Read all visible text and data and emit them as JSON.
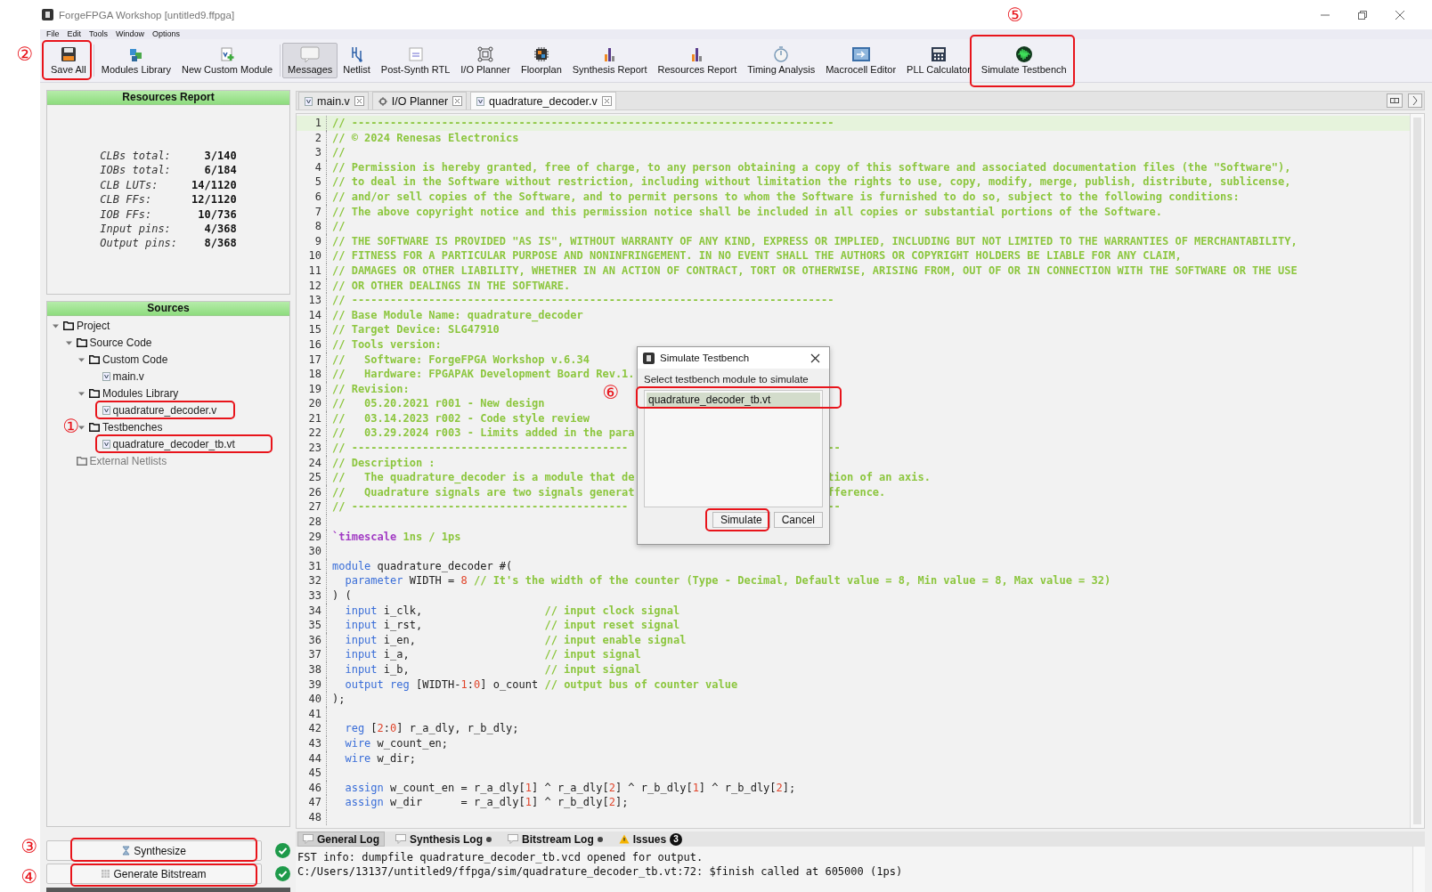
{
  "window": {
    "title": "ForgeFPGA Workshop [untitled9.ffpga]"
  },
  "menu": [
    "File",
    "Edit",
    "Tools",
    "Window",
    "Options"
  ],
  "toolbar": [
    {
      "label": "Save All",
      "pressed": false
    },
    {
      "label": "Modules Library",
      "pressed": false
    },
    {
      "label": "New Custom Module",
      "pressed": false
    },
    {
      "label": "Messages",
      "pressed": true
    },
    {
      "label": "Netlist",
      "pressed": false
    },
    {
      "label": "Post-Synth RTL",
      "pressed": false
    },
    {
      "label": "I/O Planner",
      "pressed": false
    },
    {
      "label": "Floorplan",
      "pressed": false
    },
    {
      "label": "Synthesis Report",
      "pressed": false
    },
    {
      "label": "Resources Report",
      "pressed": false
    },
    {
      "label": "Timing Analysis",
      "pressed": false
    },
    {
      "label": "Macrocell Editor",
      "pressed": false
    },
    {
      "label": "PLL Calculator",
      "pressed": false
    },
    {
      "label": "Simulate Testbench",
      "pressed": false
    }
  ],
  "resources_report": {
    "title": "Resources Report",
    "rows": [
      {
        "label": "CLBs total:",
        "value": "3/140"
      },
      {
        "label": "IOBs total:",
        "value": "6/184"
      },
      {
        "label": "CLB LUTs:",
        "value": "14/1120"
      },
      {
        "label": "CLB FFs:",
        "value": "12/1120"
      },
      {
        "label": "IOB FFs:",
        "value": "10/736"
      },
      {
        "label": "Input pins:",
        "value": "4/368"
      },
      {
        "label": "Output pins:",
        "value": "8/368"
      }
    ]
  },
  "sources": {
    "title": "Sources",
    "tree": [
      {
        "label": "Project",
        "kind": "folder",
        "expanded": true,
        "disabled": false,
        "children": [
          {
            "label": "Source Code",
            "kind": "folder",
            "expanded": true,
            "disabled": false,
            "children": [
              {
                "label": "Custom Code",
                "kind": "folder",
                "expanded": true,
                "disabled": false,
                "children": [
                  {
                    "label": "main.v",
                    "kind": "file",
                    "disabled": false
                  }
                ]
              },
              {
                "label": "Modules Library",
                "kind": "folder",
                "expanded": true,
                "disabled": false,
                "children": [
                  {
                    "label": "quadrature_decoder.v",
                    "kind": "file",
                    "disabled": false
                  }
                ]
              },
              {
                "label": "Testbenches",
                "kind": "folder",
                "expanded": true,
                "disabled": false,
                "children": [
                  {
                    "label": "quadrature_decoder_tb.vt",
                    "kind": "file",
                    "disabled": false
                  }
                ]
              }
            ]
          },
          {
            "label": "External Netlists",
            "kind": "folder",
            "disabled": true
          }
        ]
      }
    ]
  },
  "build_steps": [
    {
      "label": "Synthesize",
      "done": true
    },
    {
      "label": "Generate Bitstream",
      "done": true
    }
  ],
  "editor": {
    "tabs": [
      {
        "label": "main.v",
        "kind": "file",
        "selected": false
      },
      {
        "label": "I/O Planner",
        "kind": "planner",
        "selected": false
      },
      {
        "label": "quadrature_decoder.v",
        "kind": "file",
        "selected": true
      }
    ],
    "lines": [
      {
        "n": "1",
        "parts": [
          [
            {
              "kind": "com",
              "text": "// ---------------------------------------------------------------------------"
            }
          ]
        ]
      },
      {
        "n": "2",
        "parts": [
          [
            {
              "kind": "com",
              "text": "// © 2024 Renesas Electronics"
            }
          ]
        ]
      },
      {
        "n": "3",
        "parts": [
          [
            {
              "kind": "com",
              "text": "//"
            }
          ]
        ]
      },
      {
        "n": "4",
        "parts": [
          [
            {
              "kind": "com",
              "text": "// Permission is hereby granted, free of charge, to any person obtaining a copy of this software and associated documentation files (the \"Software\"),"
            }
          ]
        ]
      },
      {
        "n": "5",
        "parts": [
          [
            {
              "kind": "com",
              "text": "// to deal in the Software without restriction, including without limitation the rights to use, copy, modify, merge, publish, distribute, sublicense,"
            }
          ]
        ]
      },
      {
        "n": "6",
        "parts": [
          [
            {
              "kind": "com",
              "text": "// and/or sell copies of the Software, and to permit persons to whom the Software is furnished to do so, subject to the following conditions:"
            }
          ]
        ]
      },
      {
        "n": "7",
        "parts": [
          [
            {
              "kind": "com",
              "text": "// The above copyright notice and this permission notice shall be included in all copies or substantial portions of the Software."
            }
          ]
        ]
      },
      {
        "n": "8",
        "parts": [
          [
            {
              "kind": "com",
              "text": "//"
            }
          ]
        ]
      },
      {
        "n": "9",
        "parts": [
          [
            {
              "kind": "com",
              "text": "// THE SOFTWARE IS PROVIDED \"AS IS\", WITHOUT WARRANTY OF ANY KIND, EXPRESS OR IMPLIED, INCLUDING BUT NOT LIMITED TO THE WARRANTIES OF MERCHANTABILITY,"
            }
          ]
        ]
      },
      {
        "n": "10",
        "parts": [
          [
            {
              "kind": "com",
              "text": "// FITNESS FOR A PARTICULAR PURPOSE AND NONINFRINGEMENT. IN NO EVENT SHALL THE AUTHORS OR COPYRIGHT HOLDERS BE LIABLE FOR ANY CLAIM,"
            }
          ]
        ]
      },
      {
        "n": "11",
        "parts": [
          [
            {
              "kind": "com",
              "text": "// DAMAGES OR OTHER LIABILITY, WHETHER IN AN ACTION OF CONTRACT, TORT OR OTHERWISE, ARISING FROM, OUT OF OR IN CONNECTION WITH THE SOFTWARE OR THE USE"
            }
          ]
        ]
      },
      {
        "n": "12",
        "parts": [
          [
            {
              "kind": "com",
              "text": "// OR OTHER DEALINGS IN THE SOFTWARE."
            }
          ]
        ]
      },
      {
        "n": "13",
        "parts": [
          [
            {
              "kind": "com",
              "text": "// ---------------------------------------------------------------------------"
            }
          ]
        ]
      },
      {
        "n": "14",
        "parts": [
          [
            {
              "kind": "com",
              "text": "// Base Module Name: quadrature_decoder"
            }
          ]
        ]
      },
      {
        "n": "15",
        "parts": [
          [
            {
              "kind": "com",
              "text": "// Target Device: SLG47910"
            }
          ]
        ]
      },
      {
        "n": "16",
        "parts": [
          [
            {
              "kind": "com",
              "text": "// Tools version:"
            }
          ]
        ]
      },
      {
        "n": "17",
        "parts": [
          [
            {
              "kind": "com",
              "text": "//   Software: ForgeFPGA Workshop v.6.34"
            }
          ]
        ]
      },
      {
        "n": "18",
        "parts": [
          [
            {
              "kind": "com",
              "text": "//   Hardware: FPGAPAK Development Board Rev.1."
            }
          ]
        ]
      },
      {
        "n": "19",
        "parts": [
          [
            {
              "kind": "com",
              "text": "// Revision:"
            }
          ]
        ]
      },
      {
        "n": "20",
        "parts": [
          [
            {
              "kind": "com",
              "text": "//   05.20.2021 r001 - New design"
            }
          ]
        ]
      },
      {
        "n": "21",
        "parts": [
          [
            {
              "kind": "com",
              "text": "//   03.14.2023 r002 - Code style review"
            }
          ]
        ]
      },
      {
        "n": "22",
        "parts": [
          [
            {
              "kind": "com",
              "text": "//   03.29.2024 r003 - Limits added in the para"
            }
          ]
        ]
      },
      {
        "n": "23",
        "parts": [
          [
            {
              "kind": "com",
              "text": "// -------------------------------------------"
            }
          ],
          [
            {
              "kind": "com",
              "text": "--"
            }
          ]
        ]
      },
      {
        "n": "24",
        "parts": [
          [
            {
              "kind": "com",
              "text": "// Description :"
            }
          ]
        ]
      },
      {
        "n": "25",
        "parts": [
          [
            {
              "kind": "com",
              "text": "//   The quadrature_decoder is a module that de"
            }
          ],
          [
            {
              "kind": "com",
              "text": "tion of an axis."
            }
          ]
        ]
      },
      {
        "n": "26",
        "parts": [
          [
            {
              "kind": "com",
              "text": "//   Quadrature signals are two signals generat"
            }
          ],
          [
            {
              "kind": "com",
              "text": "fference."
            }
          ]
        ]
      },
      {
        "n": "27",
        "parts": [
          [
            {
              "kind": "com",
              "text": "// -------------------------------------------"
            }
          ],
          [
            {
              "kind": "com",
              "text": "--"
            }
          ]
        ]
      },
      {
        "n": "28"
      },
      {
        "n": "29",
        "parts": [
          [
            {
              "kind": "dir",
              "text": "`timescale"
            },
            {
              "kind": "lit",
              "text": " 1ns / 1ps"
            }
          ]
        ]
      },
      {
        "n": "30"
      },
      {
        "n": "31",
        "parts": [
          [
            {
              "kind": "kw",
              "text": "module"
            },
            {
              "kind": "txt",
              "text": " quadrature_decoder #("
            }
          ]
        ]
      },
      {
        "n": "32",
        "parts": [
          [
            {
              "kind": "kw",
              "text": "  parameter"
            },
            {
              "kind": "txt",
              "text": " WIDTH = "
            },
            {
              "kind": "num",
              "text": "8"
            },
            {
              "kind": "com",
              "text": " // It's the width of the counter (Type - Decimal, Default value = 8, Min value = 8, Max value = 32)"
            }
          ]
        ]
      },
      {
        "n": "33",
        "parts": [
          [
            {
              "kind": "txt",
              "text": ") ("
            }
          ]
        ]
      },
      {
        "n": "34",
        "parts": [
          [
            {
              "kind": "kw",
              "text": "  input"
            },
            {
              "kind": "txt",
              "text": " i_clk,                   "
            },
            {
              "kind": "com",
              "text": "// input clock signal"
            }
          ]
        ]
      },
      {
        "n": "35",
        "parts": [
          [
            {
              "kind": "kw",
              "text": "  input"
            },
            {
              "kind": "txt",
              "text": " i_rst,                   "
            },
            {
              "kind": "com",
              "text": "// input reset signal"
            }
          ]
        ]
      },
      {
        "n": "36",
        "parts": [
          [
            {
              "kind": "kw",
              "text": "  input"
            },
            {
              "kind": "txt",
              "text": " i_en,                    "
            },
            {
              "kind": "com",
              "text": "// input enable signal"
            }
          ]
        ]
      },
      {
        "n": "37",
        "parts": [
          [
            {
              "kind": "kw",
              "text": "  input"
            },
            {
              "kind": "txt",
              "text": " i_a,                     "
            },
            {
              "kind": "com",
              "text": "// input signal"
            }
          ]
        ]
      },
      {
        "n": "38",
        "parts": [
          [
            {
              "kind": "kw",
              "text": "  input"
            },
            {
              "kind": "txt",
              "text": " i_b,                     "
            },
            {
              "kind": "com",
              "text": "// input signal"
            }
          ]
        ]
      },
      {
        "n": "39",
        "parts": [
          [
            {
              "kind": "kw",
              "text": "  output reg"
            },
            {
              "kind": "txt",
              "text": " [WIDTH-"
            },
            {
              "kind": "num",
              "text": "1"
            },
            {
              "kind": "txt",
              "text": ":"
            },
            {
              "kind": "num",
              "text": "0"
            },
            {
              "kind": "txt",
              "text": "] o_count "
            },
            {
              "kind": "com",
              "text": "// output bus of counter value"
            }
          ]
        ]
      },
      {
        "n": "40",
        "parts": [
          [
            {
              "kind": "txt",
              "text": ");"
            }
          ]
        ]
      },
      {
        "n": "41"
      },
      {
        "n": "42",
        "parts": [
          [
            {
              "kind": "kw",
              "text": "  reg"
            },
            {
              "kind": "txt",
              "text": " ["
            },
            {
              "kind": "num",
              "text": "2"
            },
            {
              "kind": "txt",
              "text": ":"
            },
            {
              "kind": "num",
              "text": "0"
            },
            {
              "kind": "txt",
              "text": "] r_a_dly, r_b_dly;"
            }
          ]
        ]
      },
      {
        "n": "43",
        "parts": [
          [
            {
              "kind": "kw",
              "text": "  wire"
            },
            {
              "kind": "txt",
              "text": " w_count_en;"
            }
          ]
        ]
      },
      {
        "n": "44",
        "parts": [
          [
            {
              "kind": "kw",
              "text": "  wire"
            },
            {
              "kind": "txt",
              "text": " w_dir;"
            }
          ]
        ]
      },
      {
        "n": "45"
      },
      {
        "n": "46",
        "parts": [
          [
            {
              "kind": "kw",
              "text": "  assign"
            },
            {
              "kind": "txt",
              "text": " w_count_en = r_a_dly["
            },
            {
              "kind": "num",
              "text": "1"
            },
            {
              "kind": "txt",
              "text": "] ^ r_a_dly["
            },
            {
              "kind": "num",
              "text": "2"
            },
            {
              "kind": "txt",
              "text": "] ^ r_b_dly["
            },
            {
              "kind": "num",
              "text": "1"
            },
            {
              "kind": "txt",
              "text": "] ^ r_b_dly["
            },
            {
              "kind": "num",
              "text": "2"
            },
            {
              "kind": "txt",
              "text": "];"
            }
          ]
        ]
      },
      {
        "n": "47",
        "parts": [
          [
            {
              "kind": "kw",
              "text": "  assign"
            },
            {
              "kind": "txt",
              "text": " w_dir      = r_a_dly["
            },
            {
              "kind": "num",
              "text": "1"
            },
            {
              "kind": "txt",
              "text": "] ^ r_b_dly["
            },
            {
              "kind": "num",
              "text": "2"
            },
            {
              "kind": "txt",
              "text": "];"
            }
          ]
        ]
      },
      {
        "n": "48"
      }
    ]
  },
  "dialog": {
    "title": "Simulate Testbench",
    "prompt": "Select testbench module to simulate",
    "items": [
      {
        "label": "quadrature_decoder_tb.vt",
        "selected": true
      }
    ],
    "buttons": [
      "Simulate",
      "Cancel"
    ]
  },
  "log": {
    "tabs": [
      {
        "label": "General Log",
        "kind": "log",
        "selected": true,
        "indicator": false
      },
      {
        "label": "Synthesis Log",
        "kind": "log",
        "selected": false,
        "indicator": true
      },
      {
        "label": "Bitstream Log",
        "kind": "log",
        "selected": false,
        "indicator": true
      },
      {
        "label": "Issues",
        "kind": "issues",
        "selected": false,
        "indicator": false,
        "count": "3"
      }
    ],
    "lines": [
      "FST info: dumpfile quadrature_decoder_tb.vcd opened for output.",
      "C:/Users/13137/untitled9/ffpga/sim/quadrature_decoder_tb.vt:72: $finish called at 605000 (1ps)"
    ]
  },
  "annotations": [
    {
      "marker": "①"
    },
    {
      "marker": "②"
    },
    {
      "marker": "③"
    },
    {
      "marker": "④"
    },
    {
      "marker": "⑤"
    },
    {
      "marker": "⑥"
    }
  ]
}
